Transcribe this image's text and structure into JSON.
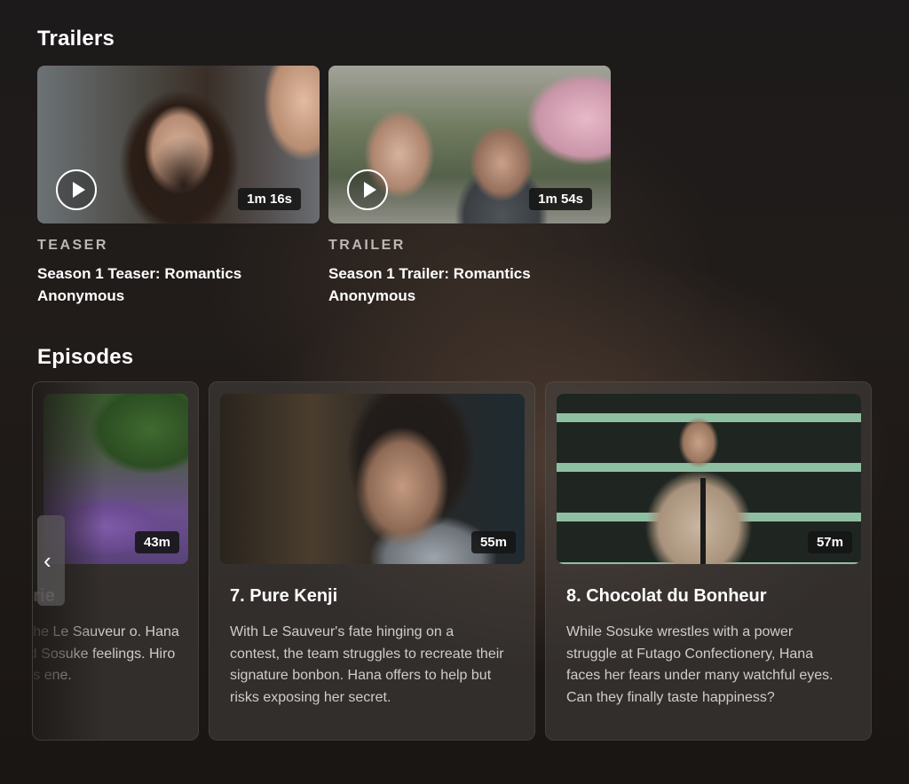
{
  "trailers": {
    "title": "Trailers",
    "items": [
      {
        "kind": "TEASER",
        "title": "Season 1 Teaser: Romantics Anonymous",
        "duration": "1m 16s"
      },
      {
        "kind": "TRAILER",
        "title": "Season 1 Trailer: Romantics Anonymous",
        "duration": "1m 54s"
      }
    ]
  },
  "episodes": {
    "title": "Episodes",
    "items": [
      {
        "title": "serie",
        "duration": "43m",
        "description": "n, the Le Sauveur o. Hana and Sosuke feelings. Hiro tags ene."
      },
      {
        "title": "7. Pure Kenji",
        "duration": "55m",
        "description": "With Le Sauveur's fate hinging on a contest, the team struggles to recreate their signature bonbon. Hana offers to help but risks exposing her secret."
      },
      {
        "title": "8. Chocolat du Bonheur",
        "duration": "57m",
        "description": "While Sosuke wrestles with a power struggle at Futago Confectionery, Hana faces her fears under many watchful eyes. Can they finally taste happiness?"
      }
    ],
    "nav_prev": "‹"
  },
  "icons": {
    "play": "play-icon",
    "prev": "chevron-left-icon"
  }
}
